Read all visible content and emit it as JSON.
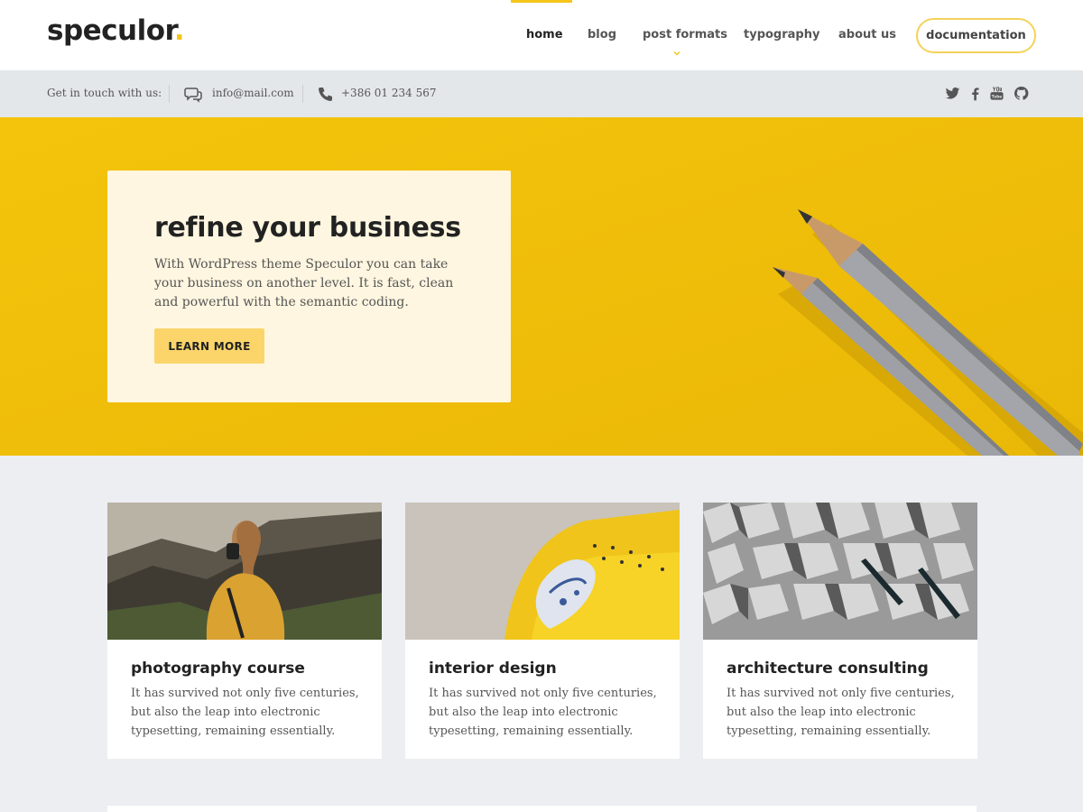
{
  "header": {
    "logo_text": "speculor",
    "logo_dot": ".",
    "nav": [
      {
        "label": "home",
        "active": true
      },
      {
        "label": "blog"
      },
      {
        "label": "post formats",
        "has_dropdown": true
      },
      {
        "label": "typography"
      },
      {
        "label": "about us"
      }
    ],
    "documentation_label": "documentation"
  },
  "contact": {
    "intro": "Get in touch with us:",
    "email": "info@mail.com",
    "phone": "+386 01 234 567",
    "social_icons": [
      "twitter-icon",
      "facebook-icon",
      "youtube-icon",
      "github-icon"
    ]
  },
  "hero": {
    "title": "refine your business",
    "text": "With WordPress theme Speculor you can take your business on another level. It is fast, clean and powerful with the semantic coding.",
    "button_label": "LEARN MORE"
  },
  "cards": [
    {
      "title": "photography course",
      "text": "It has survived not only five centuries, but also the leap into electronic typesetting, remaining essentially."
    },
    {
      "title": "interior design",
      "text": "It has survived not only five centuries, but also the leap into electronic typesetting, remaining essentially."
    },
    {
      "title": "architecture consulting",
      "text": "It has survived not only five centuries, but also the leap into electronic typesetting, remaining essentially."
    }
  ],
  "colors": {
    "accent": "#f5c518",
    "hero_bg": "#f2c20b",
    "hero_card_bg": "#fef6e0",
    "button_bg": "#fbd56a",
    "page_bg": "#eceef2",
    "contact_bar_bg": "#e4e7ea"
  }
}
